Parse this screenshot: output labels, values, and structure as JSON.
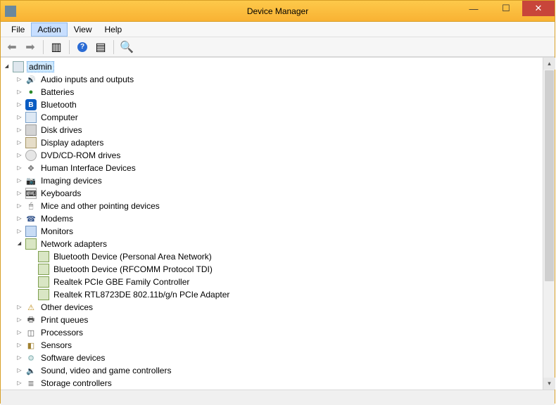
{
  "window": {
    "title": "Device Manager"
  },
  "menu": {
    "file": "File",
    "action": "Action",
    "view": "View",
    "help": "Help"
  },
  "tree": {
    "root": "admin",
    "cats": [
      {
        "label": "Audio inputs and outputs",
        "icon": "audio",
        "exp": "closed"
      },
      {
        "label": "Batteries",
        "icon": "batt",
        "exp": "closed"
      },
      {
        "label": "Bluetooth",
        "icon": "bt",
        "exp": "closed"
      },
      {
        "label": "Computer",
        "icon": "comp",
        "exp": "closed"
      },
      {
        "label": "Disk drives",
        "icon": "disk",
        "exp": "closed"
      },
      {
        "label": "Display adapters",
        "icon": "disp",
        "exp": "closed"
      },
      {
        "label": "DVD/CD-ROM drives",
        "icon": "dvd",
        "exp": "closed"
      },
      {
        "label": "Human Interface Devices",
        "icon": "hid",
        "exp": "closed"
      },
      {
        "label": "Imaging devices",
        "icon": "img",
        "exp": "closed"
      },
      {
        "label": "Keyboards",
        "icon": "kb",
        "exp": "closed"
      },
      {
        "label": "Mice and other pointing devices",
        "icon": "mouse",
        "exp": "closed"
      },
      {
        "label": "Modems",
        "icon": "modem",
        "exp": "closed"
      },
      {
        "label": "Monitors",
        "icon": "mon",
        "exp": "closed"
      },
      {
        "label": "Network adapters",
        "icon": "net",
        "exp": "open",
        "children": [
          {
            "label": "Bluetooth Device (Personal Area Network)"
          },
          {
            "label": "Bluetooth Device (RFCOMM Protocol TDI)"
          },
          {
            "label": "Realtek PCIe GBE Family Controller"
          },
          {
            "label": "Realtek RTL8723DE 802.11b/g/n PCIe Adapter"
          }
        ]
      },
      {
        "label": "Other devices",
        "icon": "dev",
        "exp": "closed"
      },
      {
        "label": "Print queues",
        "icon": "print",
        "exp": "closed"
      },
      {
        "label": "Processors",
        "icon": "cpu",
        "exp": "closed"
      },
      {
        "label": "Sensors",
        "icon": "sens",
        "exp": "closed"
      },
      {
        "label": "Software devices",
        "icon": "sw",
        "exp": "closed"
      },
      {
        "label": "Sound, video and game controllers",
        "icon": "snd",
        "exp": "closed"
      },
      {
        "label": "Storage controllers",
        "icon": "stor",
        "exp": "closed"
      }
    ]
  },
  "icons": {
    "audio": "🔊",
    "batt": "●",
    "bt": "B",
    "comp": "",
    "disk": "",
    "disp": "",
    "dvd": "",
    "hid": "✥",
    "img": "📷",
    "kb": "⌨",
    "mouse": "🖱",
    "modem": "☎",
    "mon": "",
    "net": "",
    "dev": "⚠",
    "print": "🖶",
    "cpu": "◫",
    "sens": "◧",
    "sw": "⚙",
    "snd": "🔈",
    "stor": "≣",
    "pc": ""
  }
}
